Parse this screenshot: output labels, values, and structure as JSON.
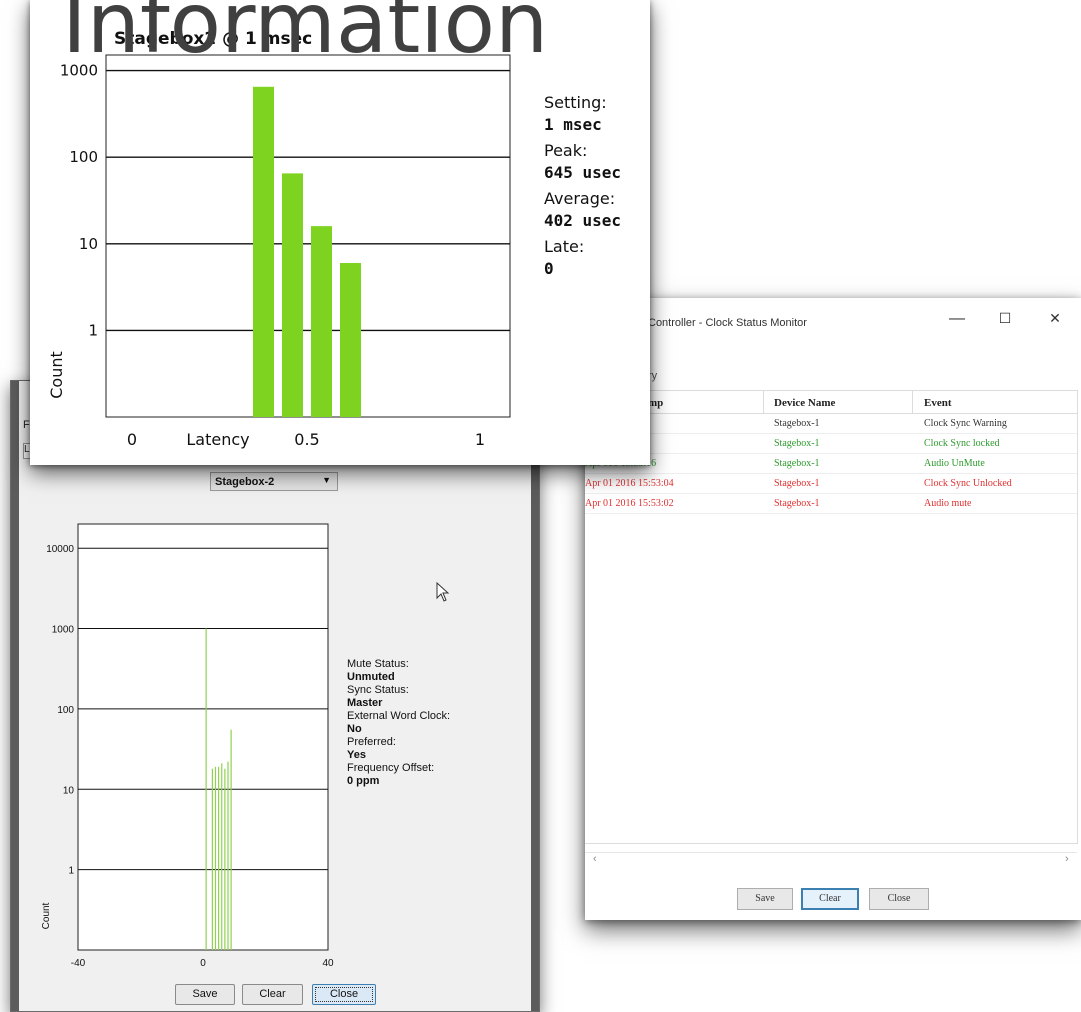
{
  "heading": "Information",
  "clock_monitor": {
    "title": "Controller - Clock Status Monitor",
    "group_label": "ry",
    "columns": [
      "mp",
      "Device Name",
      "Event"
    ],
    "rows": [
      {
        "time": "016 15:53:17",
        "device": "Stagebox-1",
        "event": "Clock Sync Warning",
        "color": "#333333"
      },
      {
        "time": "016 15:53:16",
        "device": "Stagebox-1",
        "event": "Clock Sync locked",
        "color": "#2e9a2e"
      },
      {
        "time": "Apr 016 15:53:16",
        "device": "Stagebox-1",
        "event": "Audio UnMute",
        "color": "#2e9a2e"
      },
      {
        "time": "Apr 01 2016 15:53:04",
        "device": "Stagebox-1",
        "event": "Clock Sync Unlocked",
        "color": "#e03030"
      },
      {
        "time": "Apr 01 2016 15:53:02",
        "device": "Stagebox-1",
        "event": "Audio mute",
        "color": "#e03030"
      }
    ],
    "buttons": {
      "save": "Save",
      "clear": "Clear",
      "close": "Close"
    },
    "window_controls": {
      "minimize": "—",
      "maximize": "☐",
      "close": "✕"
    },
    "scroll_left": "‹",
    "scroll_right": "›"
  },
  "latency_window": {
    "menu_letter": "F",
    "tab_letter": "L",
    "device_select": "Stagebox-2",
    "stats": [
      {
        "label": "Mute Status:",
        "value": "Unmuted"
      },
      {
        "label": "Sync Status:",
        "value": "Master"
      },
      {
        "label": "External Word Clock:",
        "value": "No"
      },
      {
        "label": "Preferred:",
        "value": "Yes"
      },
      {
        "label": "Frequency Offset:",
        "value": "0 ppm"
      }
    ],
    "buttons": {
      "save": "Save",
      "clear": "Clear",
      "close": "Close"
    }
  },
  "popup": {
    "title": "Stagebox2 @ 1 msec",
    "stats": [
      {
        "label": "Setting:",
        "value": "1 msec"
      },
      {
        "label": "Peak:",
        "value": "645 usec"
      },
      {
        "label": "Average:",
        "value": "402 usec"
      },
      {
        "label": "Late:",
        "value": "0"
      }
    ]
  },
  "chart_data": [
    {
      "type": "bar",
      "title": "Stagebox2 @ 1 msec",
      "xlabel": "Latency",
      "ylabel": "Count",
      "y_scale": "log",
      "ylim": [
        0.1,
        1000
      ],
      "xlim": [
        -0.3,
        1.2
      ],
      "y_ticks": [
        "1000",
        "100",
        "10",
        "1"
      ],
      "x_ticks": [
        "0",
        "0.5",
        "1"
      ],
      "color": "#7ed321",
      "bars": [
        {
          "x": 0.4,
          "value": 650
        },
        {
          "x": 0.5,
          "value": 65
        },
        {
          "x": 0.6,
          "value": 16
        },
        {
          "x": 0.7,
          "value": 6
        }
      ],
      "grid": true
    },
    {
      "type": "bar",
      "title": "",
      "xlabel": "",
      "ylabel": "Count",
      "y_scale": "log",
      "ylim": [
        0.1,
        20000
      ],
      "xlim": [
        -40,
        40
      ],
      "y_ticks": [
        "10000",
        "1000",
        "100",
        "10",
        "1"
      ],
      "x_ticks": [
        "-40",
        "0",
        "40"
      ],
      "color": "#8fd14f",
      "bars": [
        {
          "x": 1,
          "value": 1000
        },
        {
          "x": 3,
          "value": 18
        },
        {
          "x": 4,
          "value": 19
        },
        {
          "x": 5,
          "value": 19
        },
        {
          "x": 6,
          "value": 21
        },
        {
          "x": 7,
          "value": 18
        },
        {
          "x": 8,
          "value": 22
        },
        {
          "x": 9,
          "value": 55
        }
      ],
      "grid": true
    }
  ]
}
